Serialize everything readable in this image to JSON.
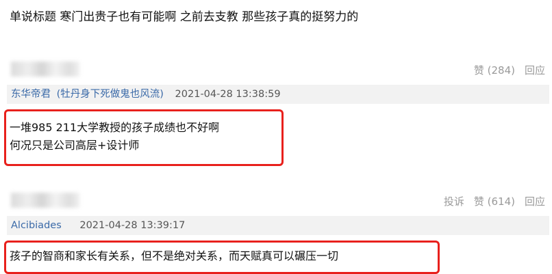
{
  "post_text": "单说标题 寒门出贵子也有可能啊 之前去支教 那些孩子真的挺努力的",
  "comments": [
    {
      "like_label": "赞",
      "like_count": "(284)",
      "reply_label": "回应",
      "author": "东华帝君",
      "author_note": "(牡丹身下死做鬼也风流)",
      "timestamp": "2021-04-28 13:38:59",
      "lines": [
        "一堆985 211大学教授的孩子成绩也不好啊",
        "何况只是公司高层+设计师"
      ]
    },
    {
      "report_label": "投诉",
      "like_label": "赞",
      "like_count": "(614)",
      "reply_label": "回应",
      "author": "Alcibiades",
      "timestamp": "2021-04-28 13:39:17",
      "lines": [
        "孩子的智商和家长有关系，但不是绝对关系，而天赋真可以碾压一切"
      ]
    }
  ],
  "colors": {
    "author_link": "#3b6aa8",
    "highlight_box": "#e8201c",
    "meta_bg": "#f2f2f2"
  }
}
